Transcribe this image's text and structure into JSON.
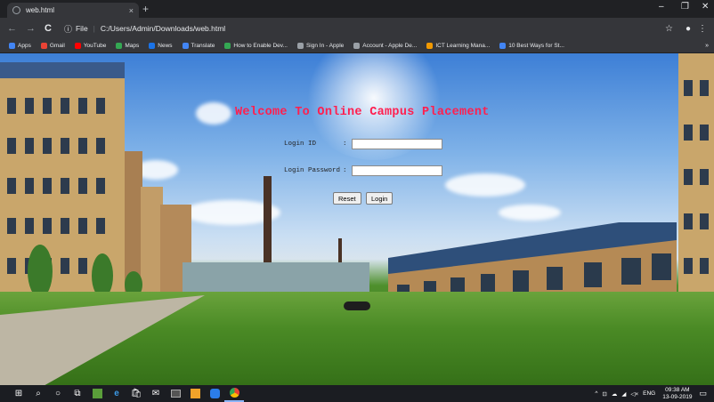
{
  "browser": {
    "tab_title": "web.html",
    "tab_close": "×",
    "new_tab": "+",
    "window_controls": [
      "–",
      "❐",
      "✕"
    ],
    "address_prefix": "File",
    "address": "C:/Users/Admin/Downloads/web.html",
    "bookmarks": [
      {
        "label": "Apps",
        "icon": "apps-grid-icon",
        "color": "#4285f4"
      },
      {
        "label": "Gmail",
        "icon": "gmail-icon",
        "color": "#ea4335"
      },
      {
        "label": "YouTube",
        "icon": "youtube-icon",
        "color": "#ff0000"
      },
      {
        "label": "Maps",
        "icon": "maps-icon",
        "color": "#34a853"
      },
      {
        "label": "News",
        "icon": "news-icon",
        "color": "#1a73e8"
      },
      {
        "label": "Translate",
        "icon": "translate-icon",
        "color": "#4285f4"
      },
      {
        "label": "How to Enable Dev...",
        "icon": "page-icon",
        "color": "#34a853"
      },
      {
        "label": "Sign In - Apple",
        "icon": "apple-icon",
        "color": "#9aa0a6"
      },
      {
        "label": "Account - Apple De...",
        "icon": "apple-icon",
        "color": "#9aa0a6"
      },
      {
        "label": "ICT Learning Mana...",
        "icon": "ict-icon",
        "color": "#f29900"
      },
      {
        "label": "10 Best Ways for St...",
        "icon": "star-icon",
        "color": "#4285f4"
      }
    ],
    "bookmarks_more": "»"
  },
  "page": {
    "heading": "Welcome To Online Campus Placement",
    "login_id_label": "Login ID",
    "login_password_label": "Login Password",
    "colon": ":",
    "login_id_value": "",
    "login_password_value": "",
    "reset_label": "Reset",
    "login_label": "Login",
    "heading_color": "#ff1f4f"
  },
  "taskbar": {
    "language": "ENG",
    "time": "09:38 AM",
    "date": "13-09-2019"
  }
}
